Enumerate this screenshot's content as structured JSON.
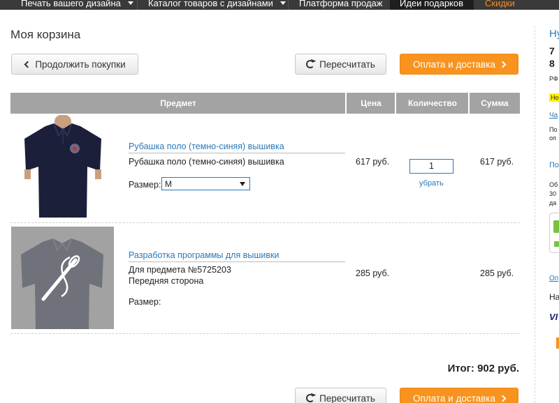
{
  "nav": {
    "items": [
      {
        "label": "Печать вашего дизайна",
        "dropdown": true
      },
      {
        "label": "Каталог товаров с дизайнами",
        "dropdown": true
      },
      {
        "label": "Платформа продаж",
        "dropdown": false
      },
      {
        "label": "Идеи подарков",
        "dropdown": false
      },
      {
        "label": "Скидки",
        "dropdown": false
      }
    ]
  },
  "page": {
    "title": "Моя корзина",
    "continue_label": "Продолжить покупки",
    "recalc_label": "Пересчитать",
    "checkout_label": "Оплата и доставка",
    "total_label": "Итог: 902 руб."
  },
  "table": {
    "headers": [
      "Предмет",
      "Цена",
      "Количество",
      "Сумма"
    ],
    "rows": [
      {
        "title": "Рубашка поло (темно-синяя) вышивка",
        "description": "Рубашка поло (темно-синяя) вышивка",
        "size_label": "Размер:",
        "size_value": "M",
        "price": "617 руб.",
        "quantity": "1",
        "remove_label": "убрать",
        "sum": "617 руб."
      },
      {
        "title": "Разработка программы для вышивки",
        "description_line1": "Для предмета №5725203",
        "description_line2": "Передняя сторона",
        "size_label": "Размер:",
        "price": "285 руб.",
        "sum": "285 руб."
      }
    ]
  },
  "sidebar": {
    "fragments": [
      "Ну",
      "7",
      "8",
      "РФ",
      "Но",
      "Ча",
      "По",
      "оп",
      "По",
      "Об",
      "30",
      "да",
      "Оп",
      "На",
      "VI"
    ]
  },
  "colors": {
    "accent_orange": "#f7931e",
    "link_blue": "#2a78b8",
    "header_gray": "#a3a3a3",
    "nav_dark": "#3a3a3a",
    "sale_orange": "#f68b1f"
  }
}
